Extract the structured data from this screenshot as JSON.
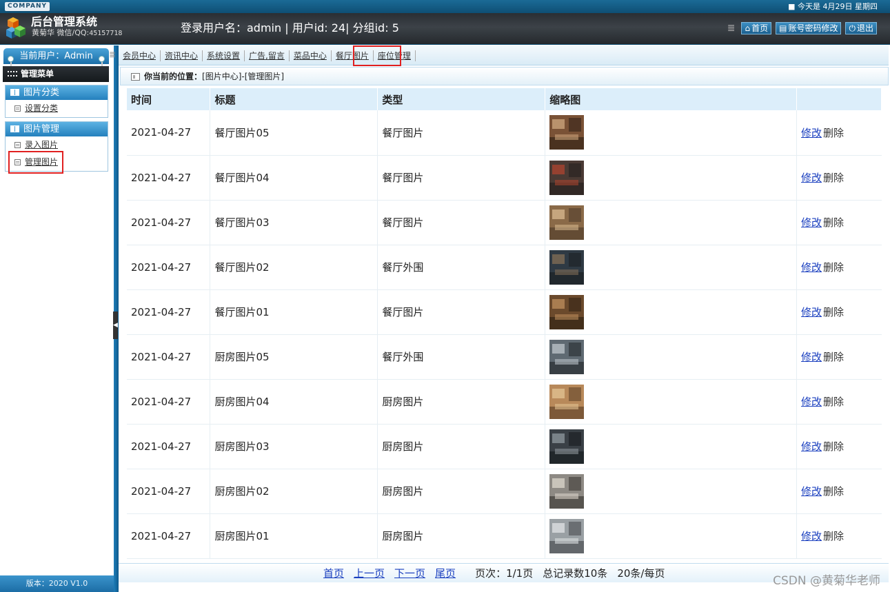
{
  "header": {
    "company_badge": "COMPANY",
    "date_text": "■ 今天是 4月29日 星期四",
    "title": "后台管理系统",
    "subtitle": "黄菊华 微信/QQ:",
    "qq": "45157718",
    "login_info": "登录用户名：admin | 用户id: 24| 分组id: 5",
    "buttons": [
      {
        "label": "首页",
        "icon": "home-icon"
      },
      {
        "label": "账号密码修改",
        "icon": "document-icon"
      },
      {
        "label": "退出",
        "icon": "power-icon"
      }
    ]
  },
  "sidebar": {
    "current_user": "当前用户：Admin",
    "menu_title": "管理菜单",
    "groups": [
      {
        "title": "图片分类",
        "items": [
          {
            "label": "设置分类"
          }
        ]
      },
      {
        "title": "图片管理",
        "items": [
          {
            "label": "录入图片"
          },
          {
            "label": "管理图片",
            "highlighted": true
          }
        ]
      }
    ],
    "version": "版本：2020 V1.0"
  },
  "nav": {
    "tabs": [
      {
        "label": "会员中心"
      },
      {
        "label": "资讯中心"
      },
      {
        "label": "系统设置"
      },
      {
        "label": "广告,留言"
      },
      {
        "label": "菜品中心"
      },
      {
        "label": "餐厅图片",
        "highlighted": true
      },
      {
        "label": "座位管理"
      }
    ]
  },
  "breadcrumb": {
    "label": "你当前的位置：",
    "path": "[图片中心]-[管理图片]"
  },
  "table": {
    "columns": [
      "时间",
      "标题",
      "类型",
      "缩略图",
      ""
    ],
    "rows": [
      {
        "time": "2021-04-27",
        "title": "餐厅图片05",
        "type": "餐厅图片",
        "edit": "修改",
        "delete": "删除"
      },
      {
        "time": "2021-04-27",
        "title": "餐厅图片04",
        "type": "餐厅图片",
        "edit": "修改",
        "delete": "删除"
      },
      {
        "time": "2021-04-27",
        "title": "餐厅图片03",
        "type": "餐厅图片",
        "edit": "修改",
        "delete": "删除"
      },
      {
        "time": "2021-04-27",
        "title": "餐厅图片02",
        "type": "餐厅外围",
        "edit": "修改",
        "delete": "删除"
      },
      {
        "time": "2021-04-27",
        "title": "餐厅图片01",
        "type": "餐厅图片",
        "edit": "修改",
        "delete": "删除"
      },
      {
        "time": "2021-04-27",
        "title": "厨房图片05",
        "type": "餐厅外围",
        "edit": "修改",
        "delete": "删除"
      },
      {
        "time": "2021-04-27",
        "title": "厨房图片04",
        "type": "厨房图片",
        "edit": "修改",
        "delete": "删除"
      },
      {
        "time": "2021-04-27",
        "title": "厨房图片03",
        "type": "厨房图片",
        "edit": "修改",
        "delete": "删除"
      },
      {
        "time": "2021-04-27",
        "title": "厨房图片02",
        "type": "厨房图片",
        "edit": "修改",
        "delete": "删除"
      },
      {
        "time": "2021-04-27",
        "title": "厨房图片01",
        "type": "厨房图片",
        "edit": "修改",
        "delete": "删除"
      }
    ]
  },
  "pager": {
    "first": "首页",
    "prev": "上一页",
    "next": "下一页",
    "last": "尾页",
    "page_info": "页次：1/1页",
    "total_info": "总记录数10条",
    "per_page": "20条/每页"
  },
  "watermark": "CSDN @黄菊华老师",
  "colors": {
    "accent_blue": "#1e7cb8",
    "header_dark": "#2a2e33",
    "highlight_red": "#e02020",
    "link": "#1a3fbf"
  }
}
